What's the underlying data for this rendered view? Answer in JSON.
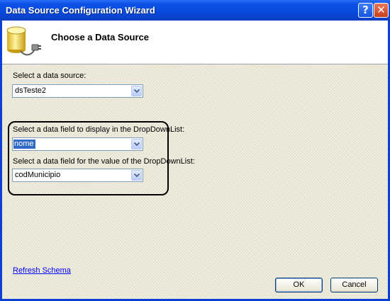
{
  "window": {
    "title": "Data Source Configuration Wizard",
    "help_glyph": "?",
    "close_glyph": "✕"
  },
  "header": {
    "title": "Choose a Data Source",
    "icon": "database-plug-icon"
  },
  "form": {
    "data_source_label": "Select a data source:",
    "data_source_value": "dsTeste2",
    "display_field_label": "Select a data field to display in the DropDownList:",
    "display_field_value": "nome",
    "value_field_label": "Select a data field for the value of the DropDownList:",
    "value_field_value": "codMunicipio"
  },
  "links": {
    "refresh_schema": "Refresh Schema"
  },
  "buttons": {
    "ok": "OK",
    "cancel": "Cancel"
  },
  "colors": {
    "titlebar": "#0a52e8",
    "selection": "#316ac5",
    "dialog_bg": "#ece9d8",
    "link": "#0000ff"
  }
}
